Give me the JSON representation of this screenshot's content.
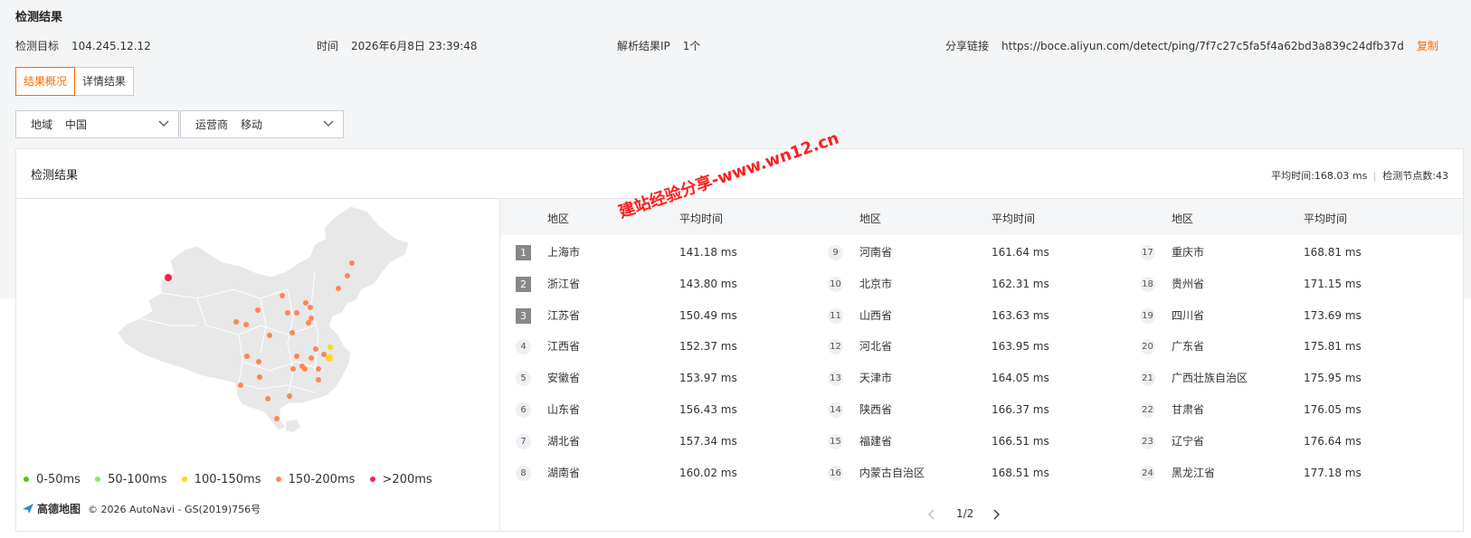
{
  "header": {
    "title": "检测结果",
    "target_label": "检测目标",
    "target_value": "104.245.12.12",
    "time_label": "时间",
    "time_value": "2026年6月8日 23:39:48",
    "ip_label": "解析结果IP",
    "ip_count": "1",
    "ip_unit": "个",
    "share_label": "分享链接",
    "share_url": "https://boce.aliyun.com/detect/ping/7f7c27c5fa5f4a62bd3a839c24dfb37d",
    "copy_label": "复制"
  },
  "tabs": [
    {
      "label": "结果概况",
      "active": true
    },
    {
      "label": "详情结果",
      "active": false
    }
  ],
  "filters": {
    "region_label": "地域",
    "region_value": "中国",
    "isp_label": "运营商",
    "isp_value": "移动"
  },
  "card": {
    "title": "检测结果",
    "avg_time": "平均时间:168.03 ms",
    "node_count": "检测节点数:43"
  },
  "legend": [
    {
      "label": "0-50ms",
      "color": "#52c41a"
    },
    {
      "label": "50-100ms",
      "color": "#95de64"
    },
    {
      "label": "100-150ms",
      "color": "#fadb14"
    },
    {
      "label": "150-200ms",
      "color": "#ff8559"
    },
    {
      "label": ">200ms",
      "color": "#f5224d"
    }
  ],
  "map_credit": {
    "brand": "高德地图",
    "text": "© 2026 AutoNavi - GS(2019)756号"
  },
  "table": {
    "col_region": "地区",
    "col_avg": "平均时间",
    "rows": [
      {
        "rank": "1",
        "region": "上海市",
        "time": "141.18 ms"
      },
      {
        "rank": "2",
        "region": "浙江省",
        "time": "143.80 ms"
      },
      {
        "rank": "3",
        "region": "江苏省",
        "time": "150.49 ms"
      },
      {
        "rank": "4",
        "region": "江西省",
        "time": "152.37 ms"
      },
      {
        "rank": "5",
        "region": "安徽省",
        "time": "153.97 ms"
      },
      {
        "rank": "6",
        "region": "山东省",
        "time": "156.43 ms"
      },
      {
        "rank": "7",
        "region": "湖北省",
        "time": "157.34 ms"
      },
      {
        "rank": "8",
        "region": "湖南省",
        "time": "160.02 ms"
      },
      {
        "rank": "9",
        "region": "河南省",
        "time": "161.64 ms"
      },
      {
        "rank": "10",
        "region": "北京市",
        "time": "162.31 ms"
      },
      {
        "rank": "11",
        "region": "山西省",
        "time": "163.63 ms"
      },
      {
        "rank": "12",
        "region": "河北省",
        "time": "163.95 ms"
      },
      {
        "rank": "13",
        "region": "天津市",
        "time": "164.05 ms"
      },
      {
        "rank": "14",
        "region": "陕西省",
        "time": "166.37 ms"
      },
      {
        "rank": "15",
        "region": "福建省",
        "time": "166.51 ms"
      },
      {
        "rank": "16",
        "region": "内蒙古自治区",
        "time": "168.51 ms"
      },
      {
        "rank": "17",
        "region": "重庆市",
        "time": "168.81 ms"
      },
      {
        "rank": "18",
        "region": "贵州省",
        "time": "171.15 ms"
      },
      {
        "rank": "19",
        "region": "四川省",
        "time": "173.69 ms"
      },
      {
        "rank": "20",
        "region": "广东省",
        "time": "175.81 ms"
      },
      {
        "rank": "21",
        "region": "广西壮族自治区",
        "time": "175.95 ms"
      },
      {
        "rank": "22",
        "region": "甘肃省",
        "time": "176.05 ms"
      },
      {
        "rank": "23",
        "region": "辽宁省",
        "time": "176.64 ms"
      },
      {
        "rank": "24",
        "region": "黑龙江省",
        "time": "177.18 ms"
      }
    ]
  },
  "pager": {
    "text": "1/2"
  },
  "watermark": "建站经验分享-www.wn12.cn"
}
